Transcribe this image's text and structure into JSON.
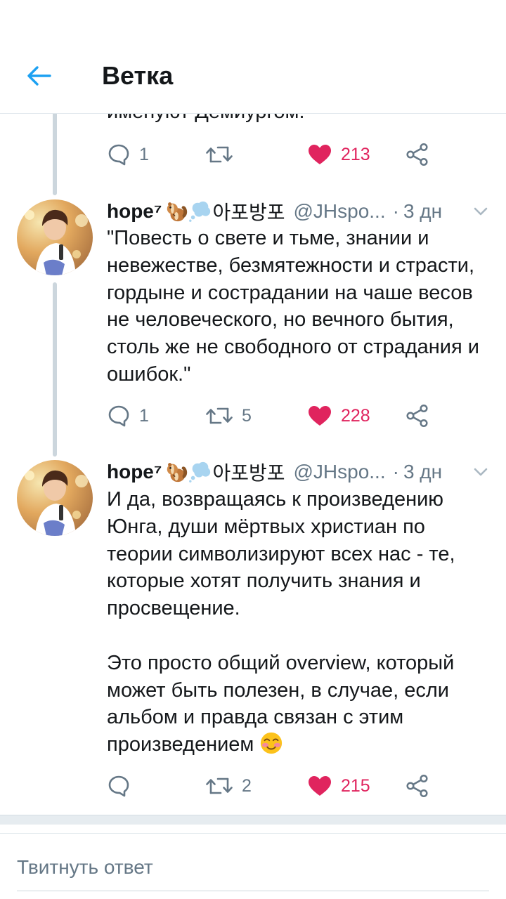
{
  "header": {
    "title": "Ветка"
  },
  "accent_color": "#1da1f2",
  "like_color": "#e0245e",
  "prev_tweet": {
    "cut_text": "именуют Демиургом.",
    "replies": "1",
    "retweets": "",
    "likes": "213"
  },
  "tweets": [
    {
      "name": "hope⁷",
      "name_suffix": "아포방포",
      "emojis": [
        "chipmunk",
        "thought-bubble"
      ],
      "handle": "@JHspo...",
      "dot": "·",
      "time": "3 дн",
      "text": "\"Повесть о свете и тьме, знании и невежестве, безмятежности и страсти, гордыне и сострадании на чаше весов не человеческого, но вечного бытия, столь же не свободного от страдания и ошибок.\"",
      "replies": "1",
      "retweets": "5",
      "likes": "228"
    },
    {
      "name": "hope⁷",
      "name_suffix": "아포방포",
      "emojis": [
        "chipmunk",
        "thought-bubble"
      ],
      "handle": "@JHspo...",
      "dot": "·",
      "time": "3 дн",
      "text": "И да, возвращаясь к произведению Юнга, души мёртвых христиан по теории символизируют всех нас - те, которые хотят получить знания и просвещение.\n\nЭто просто общий overview, который может быть полезен, в случае, если альбом и правда связан с этим произведением",
      "text_emoji": "smiling-blushing-face",
      "replies": "",
      "retweets": "2",
      "likes": "215"
    }
  ],
  "reply_bar": {
    "placeholder": "Твитнуть ответ"
  }
}
